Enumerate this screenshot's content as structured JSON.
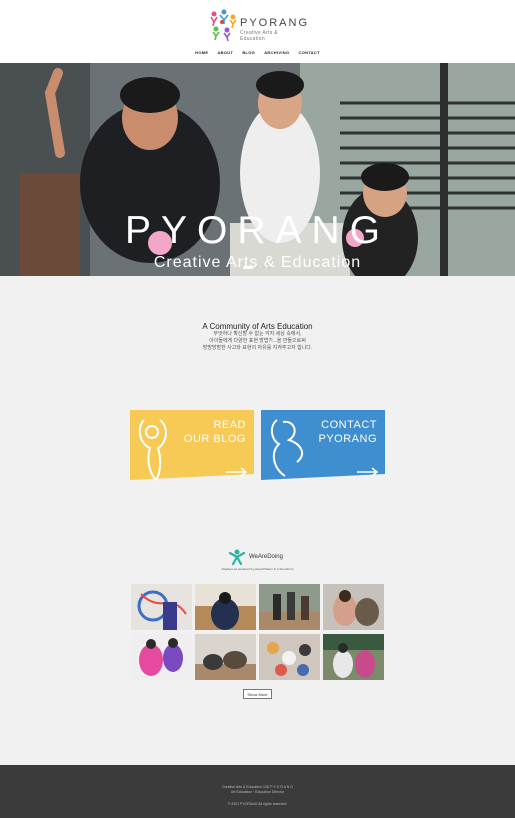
{
  "brand": {
    "name": "PYORANG",
    "tagline": "Creative Arts & Education"
  },
  "nav": {
    "items": [
      "HOME",
      "ABOUT",
      "BLOG",
      "ARCHIVING",
      "CONTACT"
    ]
  },
  "hero": {
    "title": "PYORANG",
    "subtitle": "Creative Arts & Education",
    "slide_count": 4,
    "active_slide": 1
  },
  "community": {
    "heading": "A Community of Arts Education",
    "lines": [
      "무엇하나 확신할 수 없는 각자 세상 속에서,",
      "아이들에게 다양한 표현 방법?!...을 만들으로써",
      "방방방방한 사고와 표현의 자유를 지켜주고자 합니다."
    ]
  },
  "cards": {
    "blog": {
      "line1": "READ",
      "line2": "OUR BLOG",
      "color": "#f7c955"
    },
    "contact": {
      "line1": "CONTACT",
      "line2": "PYORANG",
      "color": "#3f8fd0"
    }
  },
  "gallery": {
    "title": "WeAreDoing",
    "caption": "Displays as rendered by plecal Pattern in a Soundrom",
    "show_more": "Show More"
  },
  "footer": {
    "line1": "Creative Arts & Education 으로 P Y O R A N G",
    "line2": "Art Education  ·  Education Director",
    "copyright": "© 2021 PYORANG All rights reserved."
  }
}
